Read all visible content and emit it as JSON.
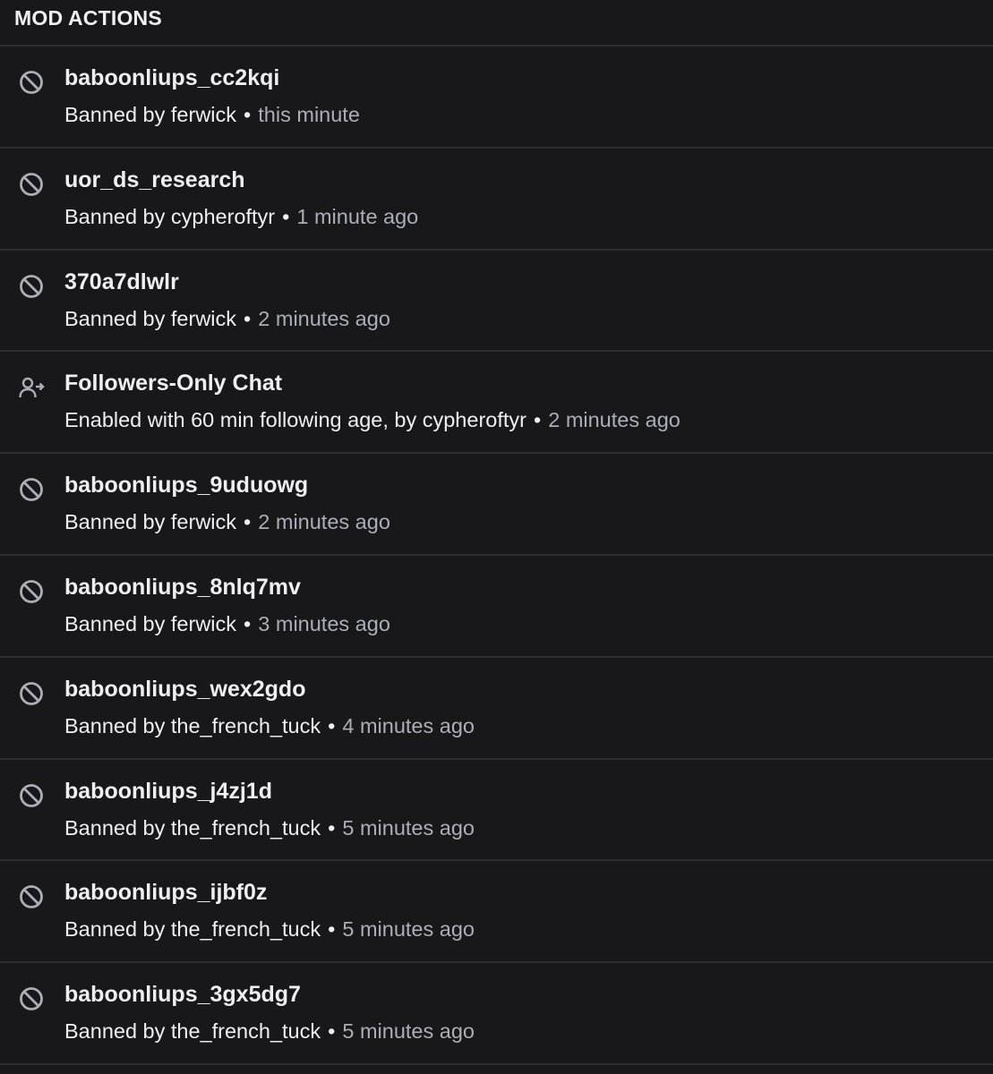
{
  "header": {
    "title": "MOD ACTIONS"
  },
  "separator": "•",
  "actions": [
    {
      "icon": "ban-icon",
      "target": "baboonliups_cc2kqi",
      "detail": "Banned by ferwick",
      "time": "this minute"
    },
    {
      "icon": "ban-icon",
      "target": "uor_ds_research",
      "detail": "Banned by cypheroftyr",
      "time": "1 minute ago"
    },
    {
      "icon": "ban-icon",
      "target": "370a7dlwlr",
      "detail": "Banned by ferwick",
      "time": "2 minutes ago"
    },
    {
      "icon": "followers-icon",
      "target": "Followers-Only Chat",
      "detail": "Enabled with 60 min following age, by cypheroftyr",
      "time": "2 minutes ago"
    },
    {
      "icon": "ban-icon",
      "target": "baboonliups_9uduowg",
      "detail": "Banned by ferwick",
      "time": "2 minutes ago"
    },
    {
      "icon": "ban-icon",
      "target": "baboonliups_8nlq7mv",
      "detail": "Banned by ferwick",
      "time": "3 minutes ago"
    },
    {
      "icon": "ban-icon",
      "target": "baboonliups_wex2gdo",
      "detail": "Banned by the_french_tuck",
      "time": "4 minutes ago"
    },
    {
      "icon": "ban-icon",
      "target": "baboonliups_j4zj1d",
      "detail": "Banned by the_french_tuck",
      "time": "5 minutes ago"
    },
    {
      "icon": "ban-icon",
      "target": "baboonliups_ijbf0z",
      "detail": "Banned by the_french_tuck",
      "time": "5 minutes ago"
    },
    {
      "icon": "ban-icon",
      "target": "baboonliups_3gx5dg7",
      "detail": "Banned by the_french_tuck",
      "time": "5 minutes ago"
    }
  ]
}
